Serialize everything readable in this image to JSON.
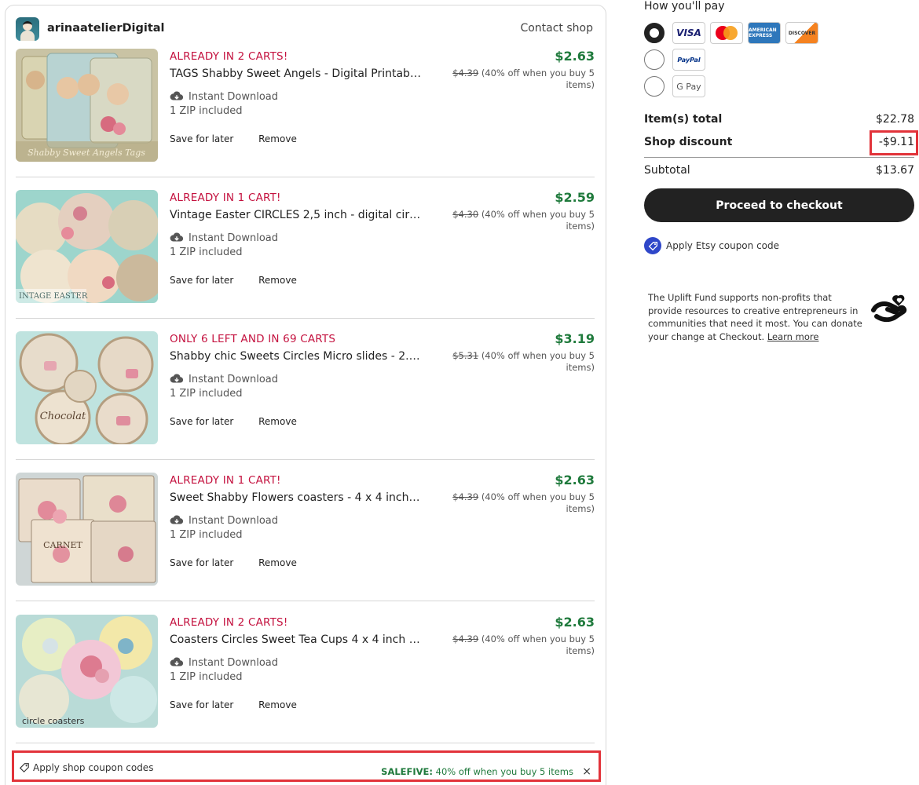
{
  "shop": {
    "name": "arinaatelierDigital",
    "contact_label": "Contact shop"
  },
  "items": [
    {
      "alert": "ALREADY IN 2 CARTS!",
      "title": "TAGS Shabby Sweet Angels - Digital Printab…",
      "download": "Instant Download",
      "zip": "1 ZIP included",
      "save_label": "Save for later",
      "remove_label": "Remove",
      "price": "$2.63",
      "old_price": "$4.39",
      "discount_note": "(40% off when you buy 5 items)",
      "image_caption": "Shabby Sweet Angels Tags"
    },
    {
      "alert": "ALREADY IN 1 CART!",
      "title": "Vintage Easter CIRCLES 2,5 inch - digital cir…",
      "download": "Instant Download",
      "zip": "1 ZIP included",
      "save_label": "Save for later",
      "remove_label": "Remove",
      "price": "$2.59",
      "old_price": "$4.30",
      "discount_note": "(40% off when you buy 5 items)",
      "image_caption": "INTAGE EASTER"
    },
    {
      "alert": "ONLY 6 LEFT AND IN 69 CARTS",
      "title": "Shabby chic Sweets Circles Micro slides - 2.…",
      "download": "Instant Download",
      "zip": "1 ZIP included",
      "save_label": "Save for later",
      "remove_label": "Remove",
      "price": "$3.19",
      "old_price": "$5.31",
      "discount_note": "(40% off when you buy 5 items)",
      "image_caption": "Chocolat"
    },
    {
      "alert": "ALREADY IN 1 CART!",
      "title": "Sweet Shabby Flowers coasters - 4 x 4 inch …",
      "download": "Instant Download",
      "zip": "1 ZIP included",
      "save_label": "Save for later",
      "remove_label": "Remove",
      "price": "$2.63",
      "old_price": "$4.39",
      "discount_note": "(40% off when you buy 5 items)",
      "image_caption": "CARNET"
    },
    {
      "alert": "ALREADY IN 2 CARTS!",
      "title": "Coasters Circles Sweet Tea Cups 4 x 4 inch …",
      "download": "Instant Download",
      "zip": "1 ZIP included",
      "save_label": "Save for later",
      "remove_label": "Remove",
      "price": "$2.63",
      "old_price": "$4.39",
      "discount_note": "(40% off when you buy 5 items)",
      "image_caption": "circle   coasters"
    }
  ],
  "coupon_bar": {
    "apply_label": "Apply shop coupon codes",
    "code": "SALEFIVE:",
    "code_desc": "40% off when you buy 5 items",
    "close": "×"
  },
  "payment": {
    "title": "How you'll pay",
    "methods": [
      "VISA",
      "mastercard",
      "AMERICAN EXPRESS",
      "DISCOVER",
      "PayPal",
      "G Pay"
    ]
  },
  "summary": {
    "items_total_label": "Item(s) total",
    "items_total": "$22.78",
    "shop_discount_label": "Shop discount",
    "shop_discount": "-$9.11",
    "subtotal_label": "Subtotal",
    "subtotal": "$13.67"
  },
  "checkout": {
    "button": "Proceed to checkout",
    "coupon_link": "Apply Etsy coupon code"
  },
  "uplift": {
    "text": "The Uplift Fund supports non-profits that provide resources to creative entrepreneurs in communities that need it most. You can donate your change at Checkout.",
    "link": "Learn more"
  },
  "colors": {
    "alert": "#c4123f",
    "price": "#1f7a3c",
    "highlight": "#e2333a",
    "checkout_bg": "#222222",
    "etsy_coupon": "#2f47c9"
  }
}
